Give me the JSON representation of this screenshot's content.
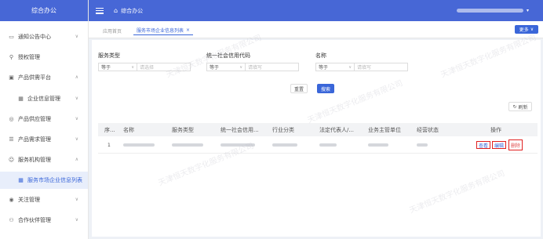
{
  "app": {
    "name": "综合办公"
  },
  "topbar": {
    "menu_icon": "hamburger-icon",
    "home_icon": "home-icon",
    "title": "综合办公"
  },
  "sidebar": {
    "items": [
      {
        "label": "通知公告中心",
        "icon": "notice-icon",
        "chevron": "∨"
      },
      {
        "label": "授权管理",
        "icon": "auth-icon",
        "chevron": ""
      },
      {
        "label": "产品供需平台",
        "icon": "box-icon",
        "chevron": "∧"
      },
      {
        "label": "企业信息管理",
        "icon": "grid-icon",
        "chevron": "∨"
      },
      {
        "label": "产品供应管理",
        "icon": "supply-icon",
        "chevron": "∨"
      },
      {
        "label": "产品需求管理",
        "icon": "list-icon",
        "chevron": "∨"
      },
      {
        "label": "服务机构管理",
        "icon": "people-icon",
        "chevron": "∧"
      },
      {
        "label": "服务市场企业信息列表",
        "icon": "grid-icon",
        "chevron": ""
      },
      {
        "label": "关注管理",
        "icon": "eye-icon",
        "chevron": "∨"
      },
      {
        "label": "合作伙伴管理",
        "icon": "partner-icon",
        "chevron": "∨"
      }
    ]
  },
  "tabs": [
    {
      "label": "应用首页"
    },
    {
      "label": "服务市场企业信息列表",
      "close": "×"
    }
  ],
  "more_button": {
    "label": "更多",
    "chevron": "∨"
  },
  "filters": [
    {
      "label": "服务类型",
      "op": "等于",
      "placeholder": "请选择"
    },
    {
      "label": "统一社会信用代码",
      "op": "等于",
      "placeholder": "请填写"
    },
    {
      "label": "名称",
      "op": "等于",
      "placeholder": "请填写"
    }
  ],
  "buttons": {
    "reset": "重置",
    "search": "搜索",
    "refresh": "刷新"
  },
  "table": {
    "headers": [
      "序...",
      "名称",
      "服务类型",
      "统一社会信用...",
      "行业分类",
      "法定代表人/...",
      "业务主管单位",
      "经营状态",
      "操作"
    ],
    "rows": [
      {
        "index": "1",
        "actions": [
          "查看",
          "编辑",
          "删除"
        ]
      }
    ]
  },
  "watermark": "天津恒天数字化服务有限公司",
  "colors": {
    "primary": "#3a66d9",
    "header": "#4767d6",
    "highlight": "#e02020"
  }
}
